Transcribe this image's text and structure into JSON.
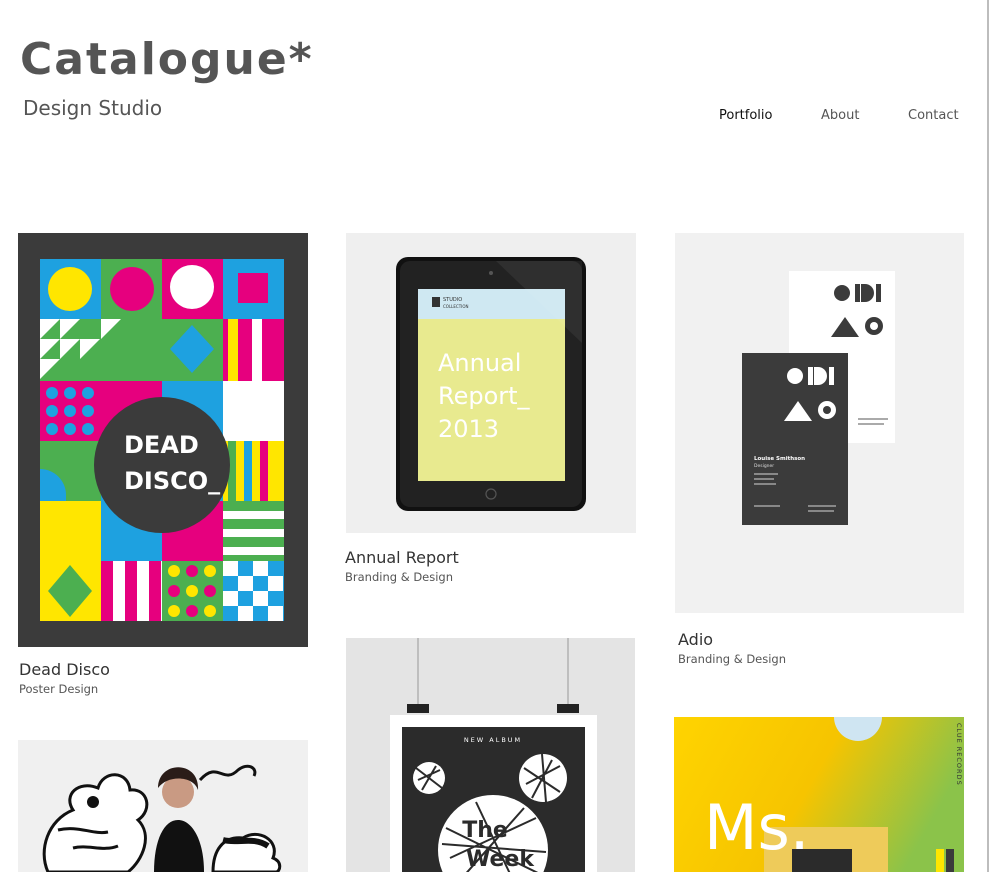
{
  "header": {
    "title": "Catalogue*",
    "subtitle": "Design Studio"
  },
  "nav": {
    "items": [
      {
        "label": "Portfolio",
        "active": true
      },
      {
        "label": "About",
        "active": false
      },
      {
        "label": "Contact",
        "active": false
      }
    ]
  },
  "portfolio": {
    "items": [
      {
        "title": "Dead Disco",
        "category": "Poster Design",
        "art_text": [
          "DEAD",
          "DISCO_"
        ]
      },
      {
        "title": "Annual Report",
        "category": "Branding & Design",
        "art_text": [
          "STUDIO",
          "COLLECTION",
          "Annual",
          "Report_",
          "2013"
        ]
      },
      {
        "title": "Adio",
        "category": "Branding & Design",
        "art_text": [
          "Louise Smithson",
          "Designer"
        ]
      },
      {
        "art_text": [
          "NEW ALBUM",
          "The",
          "Week"
        ]
      },
      {
        "art_text": [
          "Ms.",
          "CLUE RECORDS"
        ]
      }
    ]
  },
  "colors": {
    "accent_magenta": "#e6007e",
    "accent_cyan": "#1ea1e0",
    "accent_yellow": "#ffe600",
    "accent_green": "#4caf50",
    "dark": "#3b3b3b"
  }
}
